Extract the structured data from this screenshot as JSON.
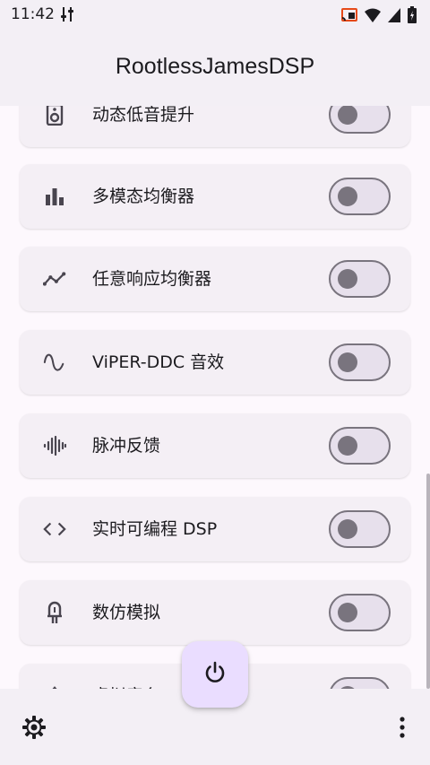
{
  "status_bar": {
    "time": "11:42",
    "icons": [
      "equalizer-settings-icon",
      "cast-icon",
      "wifi-icon",
      "signal-icon",
      "battery-icon"
    ]
  },
  "app_bar": {
    "title": "RootlessJamesDSP"
  },
  "items": [
    {
      "label": "动态低音提升",
      "icon": "speaker-icon",
      "enabled": false
    },
    {
      "label": "多模态均衡器",
      "icon": "bar-chart-icon",
      "enabled": false
    },
    {
      "label": "任意响应均衡器",
      "icon": "line-graph-icon",
      "enabled": false
    },
    {
      "label": "ViPER-DDC 音效",
      "icon": "sine-wave-icon",
      "enabled": false
    },
    {
      "label": "脉冲反馈",
      "icon": "waveform-icon",
      "enabled": false
    },
    {
      "label": "实时可编程 DSP",
      "icon": "code-brackets-icon",
      "enabled": false
    },
    {
      "label": "数仿模拟",
      "icon": "vacuum-tube-icon",
      "enabled": false
    },
    {
      "label": "虚拟音台",
      "icon": "surround-icon",
      "enabled": false
    }
  ],
  "bottom_bar": {
    "settings_icon": "gear-icon",
    "more_icon": "more-vert-icon"
  },
  "fab": {
    "icon": "power-icon"
  },
  "colors": {
    "surface": "#fdf8fd",
    "card": "#f4eff5",
    "switch_outline": "#79747e",
    "switch_track": "#e7e0ec",
    "fab": "#eaddff"
  }
}
